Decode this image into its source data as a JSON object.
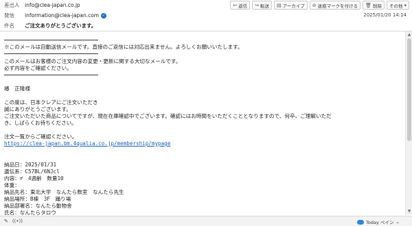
{
  "header": {
    "from_label": "差出人",
    "from_value": "info@clea-japan.co.jp",
    "sender_label": "発信",
    "sender_value": "information@clea-japan.com",
    "subject_label": "件名",
    "subject_value": "ご注文ありがとうございます。",
    "date": "2025/01/20 14:14"
  },
  "toolbar": {
    "reply": "返信",
    "forward": "転送",
    "archive": "アーカイブ",
    "spam": "迷惑マークを付ける",
    "delete": "削除",
    "other": "その他"
  },
  "email": {
    "notice1": "※このメールは自動送信メールです。直接のご返信には対応出来ません。よろしくお願いいたします。",
    "notice2": "このメールはお客様のご注文内容の変更・更新に関する大切なメールです。",
    "notice3": "必ず内容をご確認ください。",
    "salutation": "椿　正隆様",
    "p1": "この度は、日本クレアにご注文いただき",
    "p2": "誠にありがとうございます。",
    "p3": "ご注文いただいた商品についてですが、現在在庫確認中でございます。確認にはお時間をいただくこととなりますので、何卒、ご理解いただ",
    "p4": "き、しばらくお待ちください。",
    "p5": "注文一覧からご確認ください。",
    "link": "https://clea-japan.bm.4qualia.co.jp/membership/mypage",
    "d1": "納品日：2025/01/31",
    "d2": "遺伝系：C57BL/6NJcl",
    "d3": "内容：♂　4週齢　数量10",
    "d4": "体重：",
    "d5": "納品先名：東北大学　なんたら数室　なんたら先生",
    "d6": "納品場所：B棟　3F　踊り場",
    "d7": "納品部署名：なんたら動物舎",
    "d8": "氏名：なんたらタロウ"
  },
  "statusbar": {
    "weather": "Today ペイン",
    "arrow": "⌄"
  }
}
